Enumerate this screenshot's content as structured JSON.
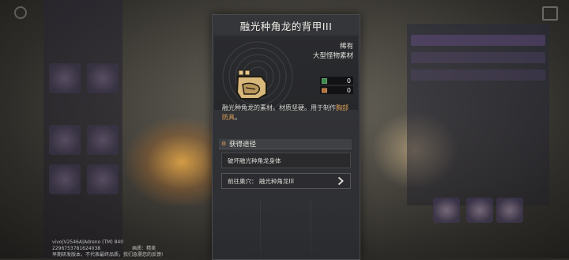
{
  "modal": {
    "title": "融光种角龙的背甲III",
    "rarity": "稀有",
    "category": "大型怪物素材",
    "counts": [
      {
        "icon": "storage-box-icon",
        "value": "0"
      },
      {
        "icon": "item-pouch-icon",
        "value": "0"
      }
    ],
    "description_prefix": "融光种角龙的素材。材质坚硬。用于制作",
    "description_highlight": "胸部防具",
    "description_suffix": "。",
    "section_title": "获得途径",
    "sources": [
      {
        "label": "破坏融光种角龙身体",
        "link": false
      },
      {
        "label": "前往巢穴：  融光种角龙III",
        "link": true
      }
    ]
  },
  "debug": {
    "line1": "vivo|V2546A|Adreno (TM) 840",
    "line2_left": "2296753781624038",
    "line2_right": "画质：精美",
    "line3": "早期研发版本，不代表最终品质，我们急需您的反馈!"
  },
  "colors": {
    "highlight": "#e0a35a",
    "panel_bg": "#2d2e31",
    "text": "#e2e2dc"
  }
}
